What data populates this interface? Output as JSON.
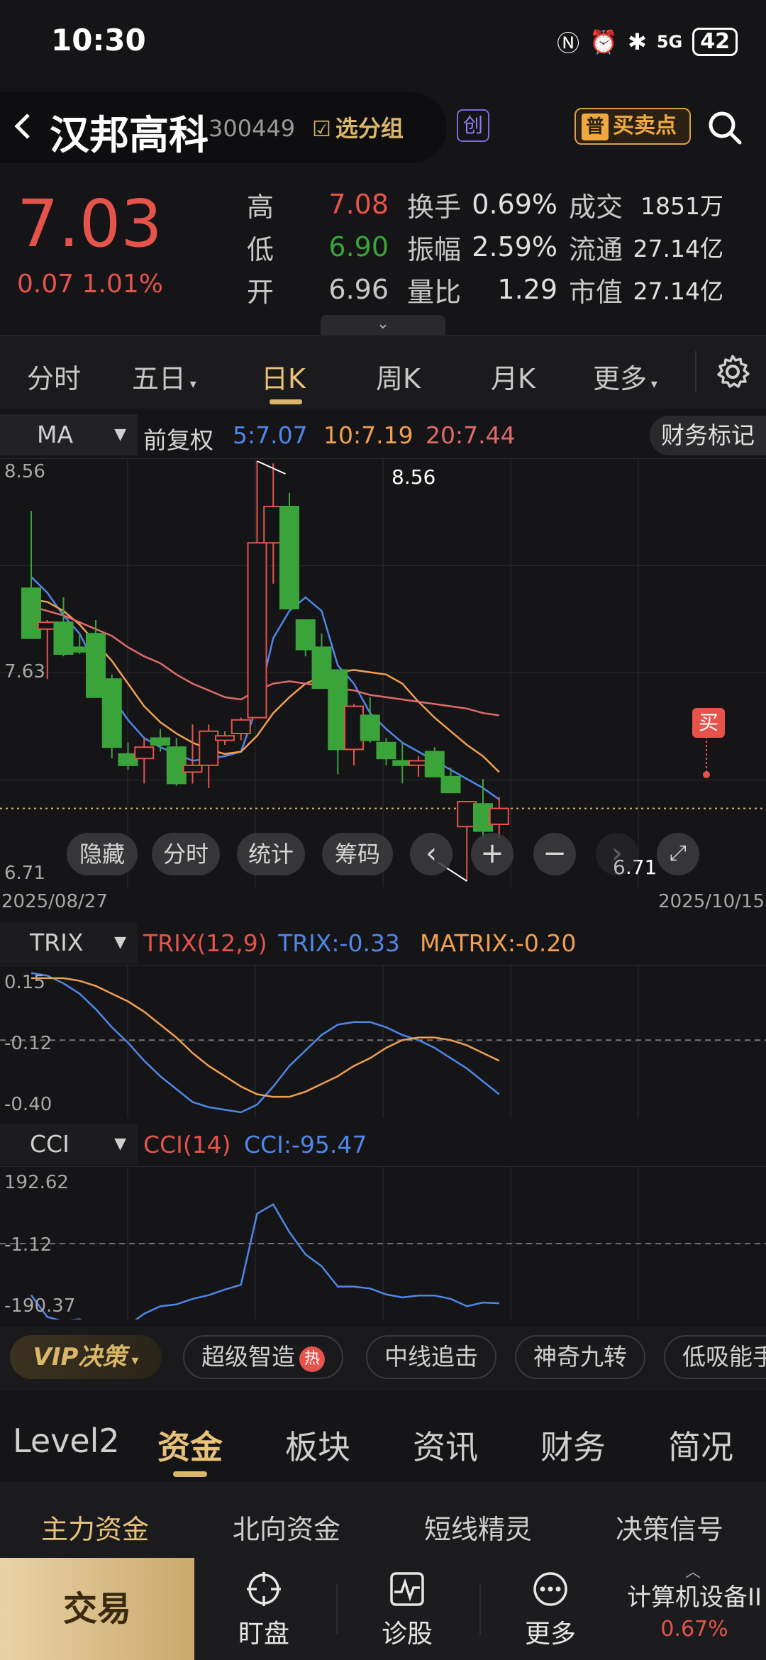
{
  "status_bar": {
    "time": "10:30",
    "network": "5G",
    "battery": "42"
  },
  "header": {
    "stock_name": "汉邦高科",
    "stock_code": "300449",
    "group_label": "选分组",
    "board_badge": "创",
    "buy_sell_badge": "普",
    "buy_sell_label": "买卖点"
  },
  "quote": {
    "price": "7.03",
    "change": "0.07  1.01%",
    "rows": [
      {
        "l1": "高",
        "v1": "7.08",
        "l2": "换手",
        "v2": "0.69%",
        "l3": "成交",
        "v3": "1851万"
      },
      {
        "l1": "低",
        "v1": "6.90",
        "l2": "振幅",
        "v2": "2.59%",
        "l3": "流通",
        "v3": "27.14亿"
      },
      {
        "l1": "开",
        "v1": "6.96",
        "l2": "量比",
        "v2": "1.29",
        "l3": "市值",
        "v3": "27.14亿"
      }
    ]
  },
  "period_tabs": [
    "分时",
    "五日",
    "日K",
    "周K",
    "月K",
    "更多"
  ],
  "active_period": "日K",
  "main_legend": {
    "indicator": "MA",
    "adjust": "前复权",
    "ma5": "5:7.07",
    "ma10": "10:7.19",
    "ma20": "20:7.44",
    "finance_mark": "财务标记"
  },
  "chart_buttons": {
    "hide": "隐藏",
    "intraday": "分时",
    "stats": "统计",
    "chips": "筹码"
  },
  "signal_label": "买",
  "colors": {
    "up": "#e5534b",
    "down": "#3aa43a",
    "ma5": "#4f86e8",
    "ma10": "#f0a050",
    "ma20": "#e06a6a",
    "accent": "#d9b66a"
  },
  "chart_data": [
    {
      "type": "candlestick",
      "title": "",
      "y_ticks": [
        "8.56",
        "7.63",
        "6.71"
      ],
      "ylim": [
        6.71,
        8.56
      ],
      "x_range_labels": [
        "2025/08/27",
        "2025/10/15"
      ],
      "annotations": {
        "high": "8.56",
        "low": "6.71"
      },
      "candles": [
        {
          "o": 8.0,
          "h": 8.34,
          "l": 7.78,
          "c": 7.78
        },
        {
          "o": 7.82,
          "h": 7.86,
          "l": 7.6,
          "c": 7.85
        },
        {
          "o": 7.85,
          "h": 7.96,
          "l": 7.7,
          "c": 7.71
        },
        {
          "o": 7.74,
          "h": 7.8,
          "l": 7.71,
          "c": 7.72
        },
        {
          "o": 7.8,
          "h": 7.86,
          "l": 7.55,
          "c": 7.52
        },
        {
          "o": 7.6,
          "h": 7.62,
          "l": 7.25,
          "c": 7.3
        },
        {
          "o": 7.27,
          "h": 7.32,
          "l": 7.2,
          "c": 7.22
        },
        {
          "o": 7.25,
          "h": 7.34,
          "l": 7.14,
          "c": 7.3
        },
        {
          "o": 7.34,
          "h": 7.38,
          "l": 7.28,
          "c": 7.31
        },
        {
          "o": 7.3,
          "h": 7.34,
          "l": 7.13,
          "c": 7.14
        },
        {
          "o": 7.19,
          "h": 7.4,
          "l": 7.14,
          "c": 7.22
        },
        {
          "o": 7.22,
          "h": 7.4,
          "l": 7.12,
          "c": 7.37
        },
        {
          "o": 7.33,
          "h": 7.37,
          "l": 7.31,
          "c": 7.35
        },
        {
          "o": 7.36,
          "h": 7.43,
          "l": 7.33,
          "c": 7.42
        },
        {
          "o": 7.43,
          "h": 8.56,
          "l": 7.43,
          "c": 8.2
        },
        {
          "o": 8.2,
          "h": 8.55,
          "l": 8.02,
          "c": 8.36
        },
        {
          "o": 8.36,
          "h": 8.42,
          "l": 7.91,
          "c": 7.91
        },
        {
          "o": 7.86,
          "h": 7.86,
          "l": 7.7,
          "c": 7.73
        },
        {
          "o": 7.74,
          "h": 7.8,
          "l": 7.57,
          "c": 7.56
        },
        {
          "o": 7.64,
          "h": 7.64,
          "l": 7.18,
          "c": 7.29
        },
        {
          "o": 7.29,
          "h": 7.49,
          "l": 7.22,
          "c": 7.48
        },
        {
          "o": 7.44,
          "h": 7.52,
          "l": 7.32,
          "c": 7.33
        },
        {
          "o": 7.32,
          "h": 7.34,
          "l": 7.22,
          "c": 7.25
        },
        {
          "o": 7.24,
          "h": 7.32,
          "l": 7.14,
          "c": 7.22
        },
        {
          "o": 7.22,
          "h": 7.26,
          "l": 7.17,
          "c": 7.24
        },
        {
          "o": 7.28,
          "h": 7.3,
          "l": 7.18,
          "c": 7.17
        },
        {
          "o": 7.17,
          "h": 7.21,
          "l": 7.1,
          "c": 7.1
        },
        {
          "o": 6.95,
          "h": 7.04,
          "l": 6.71,
          "c": 7.06
        },
        {
          "o": 7.05,
          "h": 7.16,
          "l": 6.9,
          "c": 6.93
        },
        {
          "o": 6.96,
          "h": 7.08,
          "l": 6.9,
          "c": 7.03
        }
      ],
      "series": [
        {
          "name": "5",
          "values": [
            8.05,
            7.98,
            7.88,
            7.8,
            7.66,
            7.52,
            7.42,
            7.34,
            7.3,
            7.27,
            7.24,
            7.25,
            7.26,
            7.28,
            7.48,
            7.78,
            7.9,
            7.96,
            7.9,
            7.66,
            7.58,
            7.45,
            7.38,
            7.32,
            7.28,
            7.24,
            7.2,
            7.16,
            7.12,
            7.07
          ]
        },
        {
          "name": "10",
          "values": [
            7.95,
            7.94,
            7.9,
            7.84,
            7.76,
            7.68,
            7.58,
            7.48,
            7.41,
            7.36,
            7.32,
            7.29,
            7.27,
            7.28,
            7.35,
            7.45,
            7.52,
            7.58,
            7.61,
            7.63,
            7.64,
            7.63,
            7.62,
            7.58,
            7.5,
            7.43,
            7.37,
            7.31,
            7.26,
            7.19
          ]
        },
        {
          "name": "20",
          "values": [
            7.92,
            7.9,
            7.88,
            7.85,
            7.82,
            7.79,
            7.74,
            7.7,
            7.67,
            7.62,
            7.58,
            7.55,
            7.52,
            7.51,
            7.55,
            7.58,
            7.59,
            7.58,
            7.57,
            7.56,
            7.55,
            7.53,
            7.52,
            7.51,
            7.5,
            7.49,
            7.48,
            7.47,
            7.45,
            7.44
          ]
        }
      ]
    },
    {
      "type": "line",
      "title": "",
      "indicator": "TRIX",
      "params": "TRIX(12,9)",
      "trix_label": "TRIX:-0.33",
      "matrix_label": "MATRIX:-0.20",
      "y_ticks": [
        "0.15",
        "-0.12",
        "-0.40"
      ],
      "ylim": [
        -0.4,
        0.15
      ],
      "series": [
        {
          "name": "TRIX",
          "values": [
            0.14,
            0.13,
            0.1,
            0.06,
            0.0,
            -0.07,
            -0.13,
            -0.2,
            -0.26,
            -0.31,
            -0.36,
            -0.38,
            -0.39,
            -0.4,
            -0.37,
            -0.3,
            -0.22,
            -0.16,
            -0.1,
            -0.06,
            -0.05,
            -0.05,
            -0.07,
            -0.1,
            -0.12,
            -0.15,
            -0.19,
            -0.23,
            -0.28,
            -0.33
          ]
        },
        {
          "name": "MATRIX",
          "values": [
            0.12,
            0.12,
            0.12,
            0.11,
            0.09,
            0.06,
            0.03,
            -0.01,
            -0.06,
            -0.11,
            -0.17,
            -0.22,
            -0.26,
            -0.3,
            -0.33,
            -0.34,
            -0.34,
            -0.32,
            -0.29,
            -0.26,
            -0.22,
            -0.19,
            -0.15,
            -0.12,
            -0.11,
            -0.11,
            -0.12,
            -0.14,
            -0.17,
            -0.2
          ]
        }
      ]
    },
    {
      "type": "line",
      "title": "",
      "indicator": "CCI",
      "params": "CCI(14)",
      "cci_label": "CCI:-95.47",
      "y_ticks": [
        "192.62",
        "-1.12",
        "-190.37"
      ],
      "ylim": [
        -190.37,
        192.62
      ],
      "series": [
        {
          "name": "CCI",
          "values": [
            -140,
            -199,
            -210,
            -205,
            -228,
            -240,
            -222,
            -190,
            -170,
            -165,
            -150,
            -140,
            -125,
            -112,
            80,
            105,
            30,
            -30,
            -62,
            -117,
            -117,
            -122,
            -138,
            -146,
            -141,
            -141,
            -150,
            -170,
            -160,
            -162
          ]
        }
      ]
    }
  ],
  "indicator_legends": {
    "trix": {
      "selector": "TRIX",
      "params": "TRIX(12,9)",
      "trix": "TRIX:-0.33",
      "matrix": "MATRIX:-0.20"
    },
    "cci": {
      "selector": "CCI",
      "params": "CCI(14)",
      "cci": "CCI:-95.47"
    }
  },
  "strategies": {
    "vip": "VIP决策",
    "chips": [
      "超级智造",
      "中线追击",
      "神奇九转",
      "低吸能手"
    ],
    "hot_badge": "热"
  },
  "content_tabs": [
    "Level2",
    "资金",
    "板块",
    "资讯",
    "财务",
    "简况"
  ],
  "active_content_tab": "资金",
  "sub_tabs": [
    "主力资金",
    "北向资金",
    "短线精灵",
    "决策信号"
  ],
  "bottom_nav": {
    "trade": "交易",
    "items": [
      "盯盘",
      "诊股",
      "更多"
    ],
    "sector_name": "计算机设备II",
    "sector_change": "0.67%"
  }
}
